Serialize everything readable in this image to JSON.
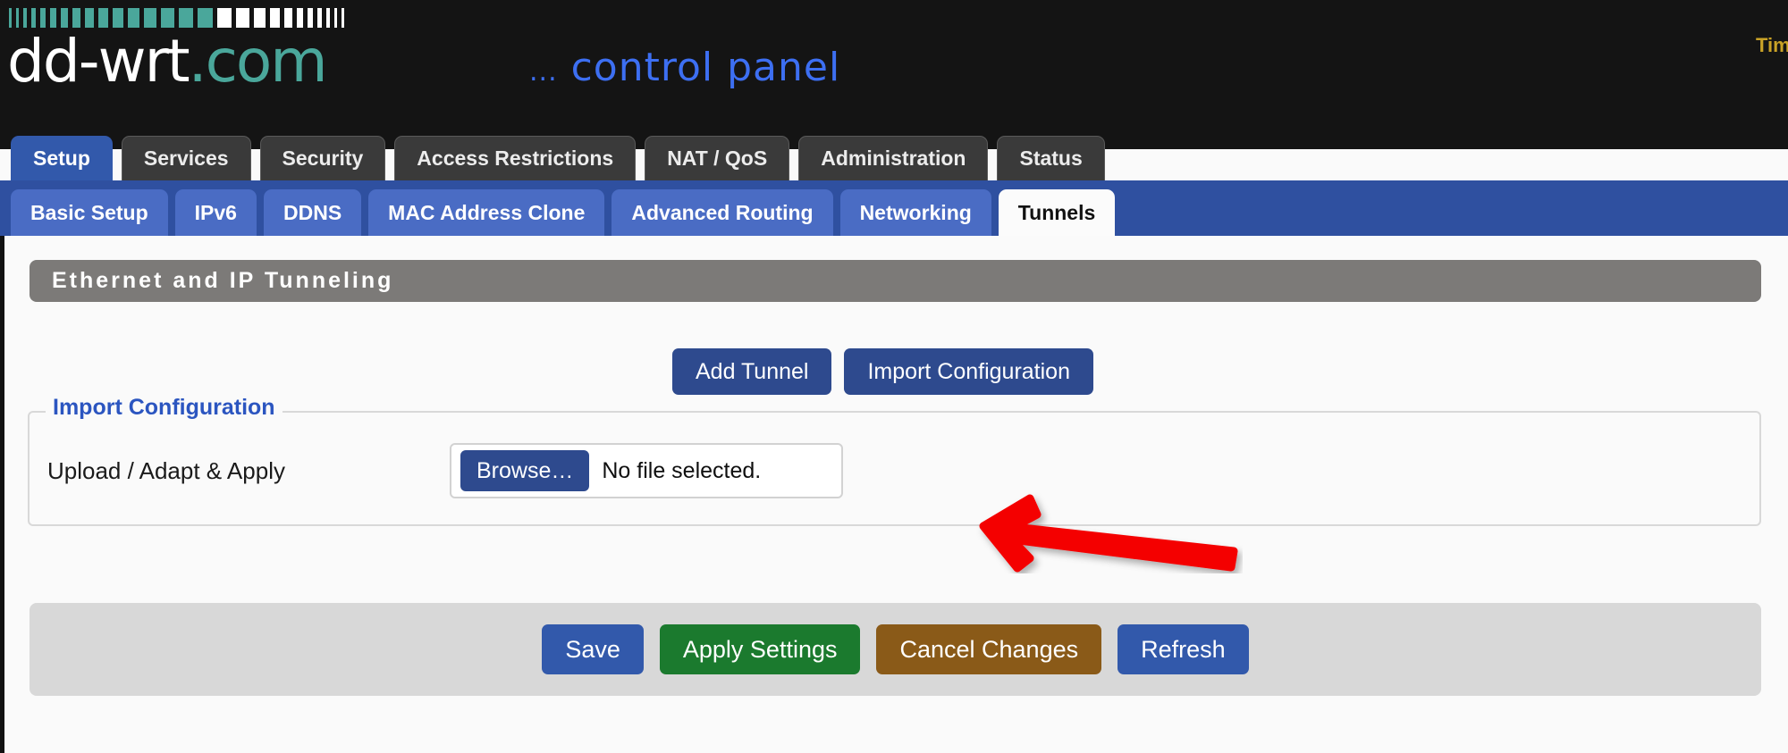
{
  "brand": {
    "logo_text": "dd-wrt",
    "logo_suffix": ".com",
    "tagline_dots": "...",
    "tagline": "control panel",
    "corner_info": "Tim",
    "teal": "#4aa79b",
    "tagline_color": "#3d6ff2"
  },
  "nav": {
    "tabs": [
      {
        "label": "Setup",
        "active": true
      },
      {
        "label": "Services",
        "active": false
      },
      {
        "label": "Security",
        "active": false
      },
      {
        "label": "Access Restrictions",
        "active": false
      },
      {
        "label": "NAT / QoS",
        "active": false
      },
      {
        "label": "Administration",
        "active": false
      },
      {
        "label": "Status",
        "active": false
      }
    ],
    "subtabs": [
      {
        "label": "Basic Setup",
        "active": false
      },
      {
        "label": "IPv6",
        "active": false
      },
      {
        "label": "DDNS",
        "active": false
      },
      {
        "label": "MAC Address Clone",
        "active": false
      },
      {
        "label": "Advanced Routing",
        "active": false
      },
      {
        "label": "Networking",
        "active": false
      },
      {
        "label": "Tunnels",
        "active": true
      }
    ]
  },
  "main": {
    "section_title": "Ethernet and IP Tunneling",
    "add_tunnel_label": "Add Tunnel",
    "import_configuration_label": "Import Configuration",
    "fieldset_legend": "Import Configuration",
    "upload_row_label": "Upload / Adapt & Apply",
    "browse_label": "Browse…",
    "file_status": "No file selected."
  },
  "footer": {
    "save_label": "Save",
    "apply_label": "Apply Settings",
    "cancel_label": "Cancel Changes",
    "refresh_label": "Refresh"
  },
  "annotation": {
    "arrow_color": "#f40000",
    "points_at": "No file selected."
  }
}
